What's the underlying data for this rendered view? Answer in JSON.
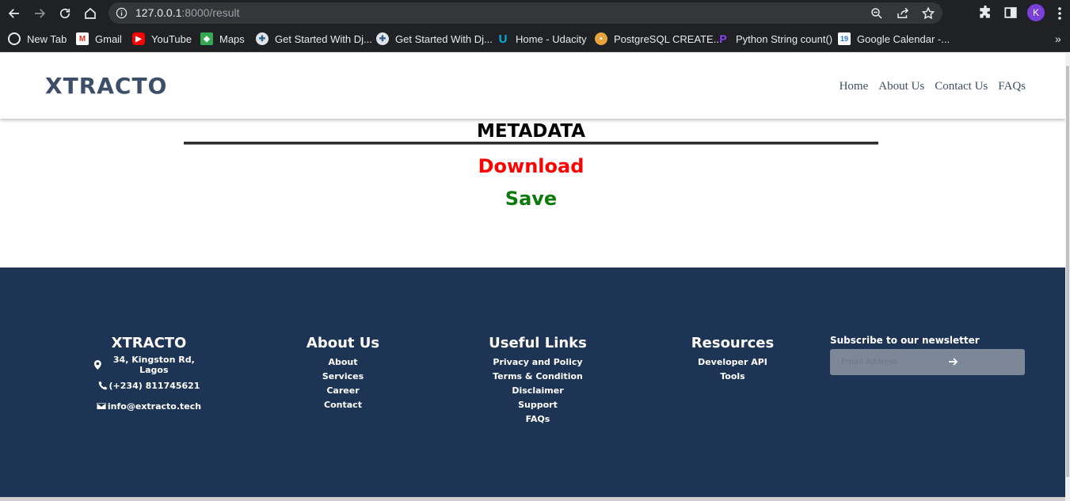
{
  "browser": {
    "url_host": "127.0.0.1",
    "url_path": ":8000/result",
    "profile_initial": "K",
    "bookmarks": [
      {
        "label": "New Tab",
        "icon": "globe-icon"
      },
      {
        "label": "Gmail",
        "icon": "gmail-icon"
      },
      {
        "label": "YouTube",
        "icon": "youtube-icon"
      },
      {
        "label": "Maps",
        "icon": "maps-icon"
      },
      {
        "label": "Get Started With Dj...",
        "icon": "python-icon"
      },
      {
        "label": "Get Started With Dj...",
        "icon": "python-icon"
      },
      {
        "label": "Home - Udacity",
        "icon": "udacity-icon"
      },
      {
        "label": "PostgreSQL CREATE...",
        "icon": "postgres-icon"
      },
      {
        "label": "Python String count()",
        "icon": "programiz-icon"
      },
      {
        "label": "Google Calendar -...",
        "icon": "calendar-icon"
      }
    ]
  },
  "header": {
    "logo": "XTRACTO",
    "nav": [
      "Home",
      "About Us",
      "Contact Us",
      "FAQs"
    ]
  },
  "main": {
    "title": "METADATA",
    "download_label": "Download",
    "save_label": "Save"
  },
  "footer": {
    "brand": {
      "title": "XTRACTO",
      "address": "34, Kingston Rd, Lagos",
      "phone": "(+234) 811745621",
      "email": "info@extracto.tech"
    },
    "about": {
      "title": "About Us",
      "links": [
        "About",
        "Services",
        "Career",
        "Contact"
      ]
    },
    "useful": {
      "title": "Useful Links",
      "links": [
        "Privacy and Policy",
        "Terms & Condition",
        "Disclaimer",
        "Support",
        "FAQs"
      ]
    },
    "resources": {
      "title": "Resources",
      "links": [
        "Developer API",
        "Tools"
      ]
    },
    "newsletter": {
      "title": "Subscribe to our newsletter",
      "placeholder": "Email Address"
    }
  },
  "colors": {
    "footer_bg": "#1e3454",
    "logo": "#3d4e68",
    "download": "#ff0000",
    "save": "#0a7a0a"
  }
}
